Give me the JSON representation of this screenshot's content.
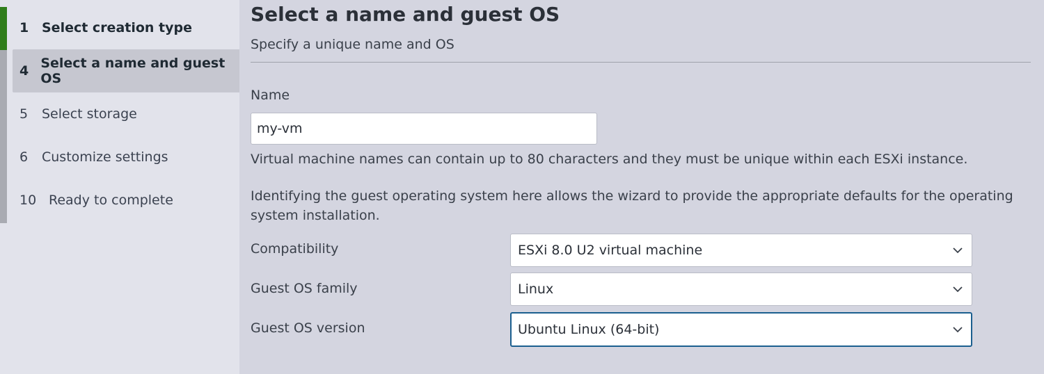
{
  "sidebar": {
    "steps": [
      {
        "number": "1",
        "label": "Select creation type",
        "state": "done"
      },
      {
        "number": "4",
        "label": "Select a name and guest OS",
        "state": "active"
      },
      {
        "number": "5",
        "label": "Select storage",
        "state": "pending"
      },
      {
        "number": "6",
        "label": "Customize settings",
        "state": "pending"
      },
      {
        "number": "10",
        "label": "Ready to complete",
        "state": "pending"
      }
    ],
    "progress_color": "#2f7d1b"
  },
  "main": {
    "title": "Select a name and guest OS",
    "subtitle": "Specify a unique name and OS",
    "name_label": "Name",
    "name_value": "my-vm",
    "name_help": "Virtual machine names can contain up to 80 characters and they must be unique within each ESXi instance.",
    "os_help": "Identifying the guest operating system here allows the wizard to provide the appropriate defaults for the operating system installation.",
    "compatibility": {
      "label": "Compatibility",
      "value": "ESXi 8.0 U2 virtual machine"
    },
    "guest_os_family": {
      "label": "Guest OS family",
      "value": "Linux"
    },
    "guest_os_version": {
      "label": "Guest OS version",
      "value": "Ubuntu Linux (64-bit)"
    }
  },
  "icons": {
    "dropdown": "chevron-down-icon"
  },
  "colors": {
    "focus_border": "#1b5f8f",
    "active_step_bg": "#c6c7d0"
  }
}
